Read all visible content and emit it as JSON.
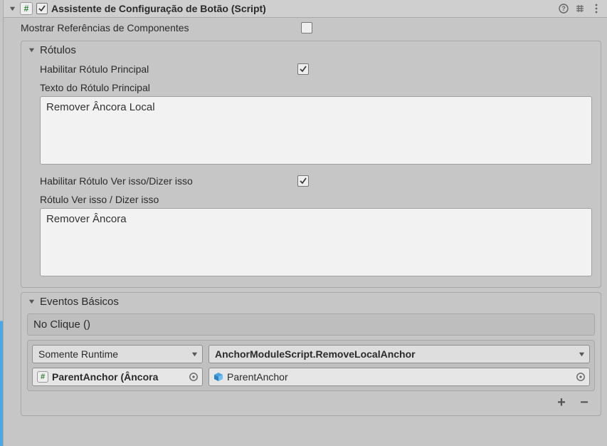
{
  "header": {
    "title": "Assistente de Configuração de Botão (Script)",
    "enabled": true
  },
  "show_refs": {
    "label": "Mostrar Referências de Componentes",
    "checked": false
  },
  "labels_section": {
    "title": "Rótulos",
    "main_toggle": {
      "label": "Habilitar Rótulo Principal",
      "checked": true
    },
    "main_text_label": "Texto do Rótulo Principal",
    "main_text_value": "Remover Âncora Local",
    "seeit_toggle": {
      "label": "Habilitar Rótulo Ver isso/Dizer isso",
      "checked": true
    },
    "seeit_text_label": "Rótulo Ver isso / Dizer isso",
    "seeit_text_value": "Remover Âncora"
  },
  "events_section": {
    "title": "Eventos Básicos",
    "subheader": "No Clique ()",
    "runtime_mode": "Somente Runtime",
    "function_name": "AnchorModuleScript.RemoveLocalAnchor",
    "object_ref_display": "ParentAnchor (Âncora",
    "param_display": "ParentAnchor"
  },
  "icons": {
    "hash": "#",
    "plus": "+",
    "minus": "−"
  }
}
